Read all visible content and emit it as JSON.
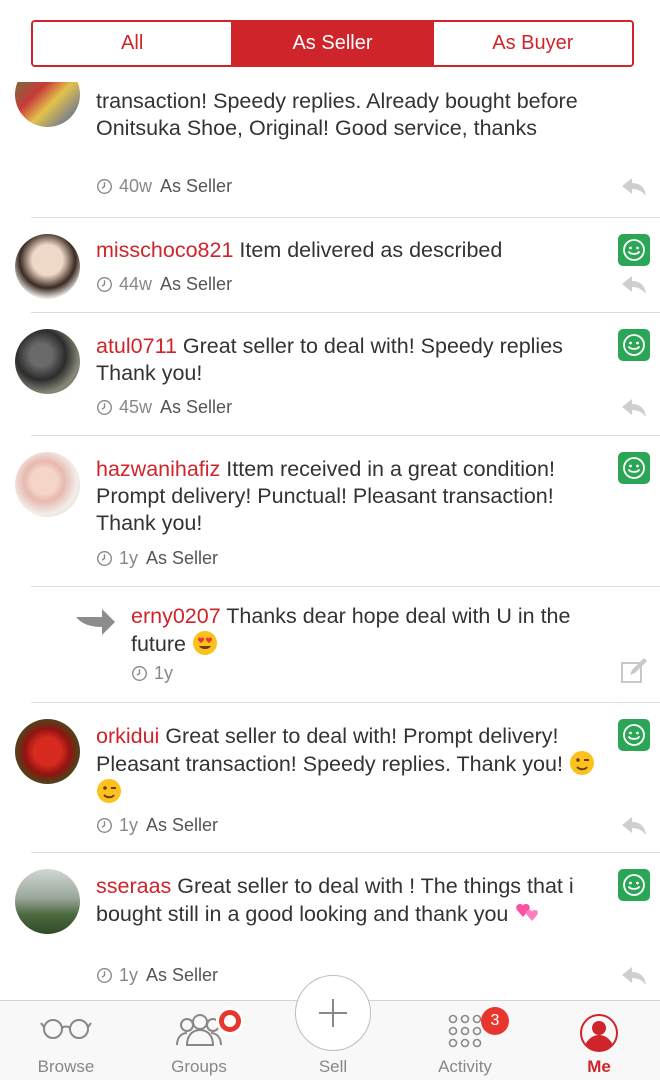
{
  "segments": [
    {
      "label": "All",
      "active": false
    },
    {
      "label": "As Seller",
      "active": true
    },
    {
      "label": "As Buyer",
      "active": false
    }
  ],
  "feedback": [
    {
      "username": "",
      "text": "transaction! Speedy replies. Already bought before Onitsuka Shoe, Original! Good service, thanks",
      "time": "40w",
      "role": "As Seller"
    },
    {
      "username": "misschoco821",
      "text": " Item delivered as described",
      "time": "44w",
      "role": "As Seller"
    },
    {
      "username": "atul0711",
      "text": " Great seller to deal with! Speedy replies Thank you!",
      "time": "45w",
      "role": "As Seller"
    },
    {
      "username": "hazwanihafiz",
      "text": " Ittem received in a great condition! Prompt delivery! Punctual! Pleasant transaction! Thank you!",
      "time": "1y",
      "role": "As Seller"
    },
    {
      "username": "erny0207",
      "text": " Thanks dear hope deal with U in the future",
      "time": "1y",
      "role": ""
    },
    {
      "username": "orkidui",
      "text": " Great seller to deal with! Prompt delivery! Pleasant transaction! Speedy replies. Thank you!",
      "time": "1y",
      "role": "As Seller"
    },
    {
      "username": "sseraas",
      "text": " Great seller to deal with ! The things that i bought still in a good looking and thank you",
      "time": "1y",
      "role": "As Seller"
    }
  ],
  "tabs": [
    {
      "label": "Browse",
      "icon": "glasses-icon"
    },
    {
      "label": "Groups",
      "icon": "groups-icon"
    },
    {
      "label": "Sell",
      "icon": "plus-icon"
    },
    {
      "label": "Activity",
      "icon": "dots-grid-icon",
      "badge": "3"
    },
    {
      "label": "Me",
      "icon": "profile-icon",
      "active": true
    }
  ],
  "colors": {
    "accent": "#d0242b",
    "positive": "#2aa656",
    "badge": "#e8362f"
  }
}
